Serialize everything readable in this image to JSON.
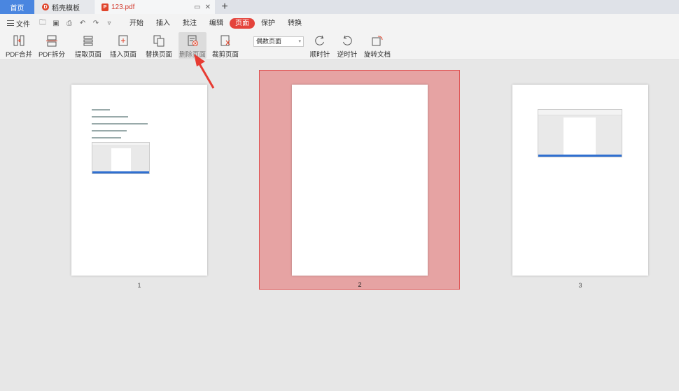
{
  "tabs": {
    "home": "首页",
    "daoke": "稻壳模板",
    "pdf": "123.pdf",
    "plus": "+"
  },
  "menubar": {
    "file": "文件",
    "items": [
      "开始",
      "插入",
      "批注",
      "编辑",
      "页面",
      "保护",
      "转换"
    ],
    "active_index": 4
  },
  "ribbon": {
    "pdf_merge": "PDF合并",
    "pdf_split": "PDF拆分",
    "extract": "提取页面",
    "insert": "插入页面",
    "replace": "替换页面",
    "delete": "删除页面",
    "crop": "裁剪页面",
    "page_select": "偶数页面",
    "clockwise": "顺时针",
    "counterclockwise": "逆时针",
    "rotate_doc": "旋转文档"
  },
  "pages": [
    {
      "number": "1"
    },
    {
      "number": "2",
      "selected": true
    },
    {
      "number": "3"
    }
  ],
  "colors": {
    "accent": "#e4433b",
    "tab_home": "#4a86e0",
    "selection": "#e6a3a3"
  }
}
